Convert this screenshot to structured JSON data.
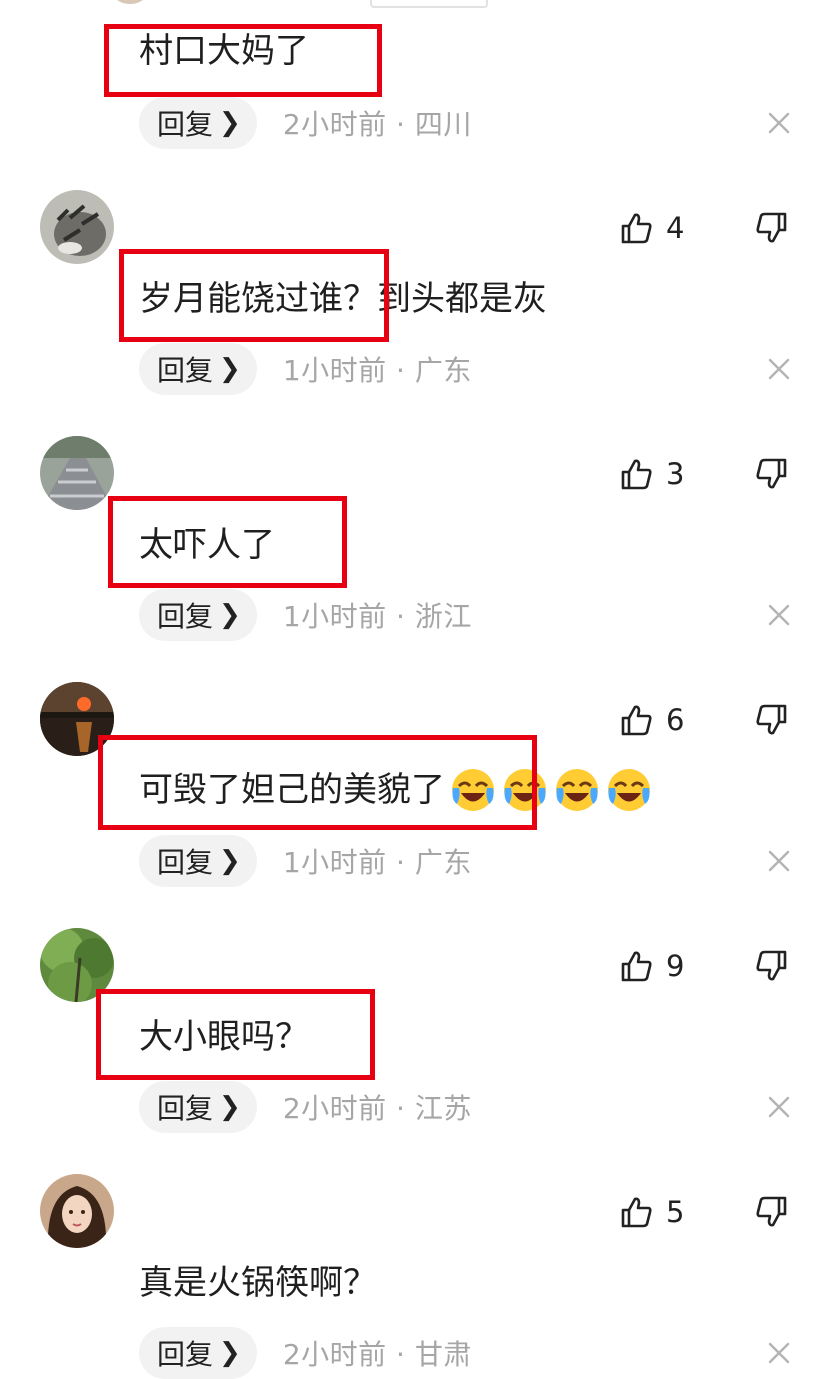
{
  "comments": [
    {
      "text": "村口大妈了",
      "reply_label": "回复",
      "time": "2小时前",
      "location": "四川",
      "likes": "",
      "avatar": "partial-avatar"
    },
    {
      "text": "岁月能饶过谁？到头都是灰",
      "reply_label": "回复",
      "time": "1小时前",
      "location": "广东",
      "likes": "4",
      "avatar": "cat-avatar"
    },
    {
      "text": "太吓人了",
      "reply_label": "回复",
      "time": "1小时前",
      "location": "浙江",
      "likes": "3",
      "avatar": "path-avatar"
    },
    {
      "text": "可毁了妲己的美貌了",
      "reply_label": "回复",
      "time": "1小时前",
      "location": "广东",
      "likes": "6",
      "avatar": "sunset-avatar",
      "emoji": [
        "crying-laughing-emoji",
        "crying-laughing-emoji",
        "crying-laughing-emoji",
        "crying-laughing-emoji"
      ]
    },
    {
      "text": "大小眼吗？",
      "reply_label": "回复",
      "time": "2小时前",
      "location": "江苏",
      "likes": "9",
      "avatar": "tree-avatar"
    },
    {
      "text": "真是火锅筷啊？",
      "reply_label": "回复",
      "time": "2小时前",
      "location": "甘肃",
      "likes": "5",
      "avatar": "woman-avatar"
    }
  ],
  "separator": "·",
  "colors": {
    "highlight": "#e60012",
    "meta": "#a6a6a6",
    "reply_bg": "#f2f2f2"
  }
}
